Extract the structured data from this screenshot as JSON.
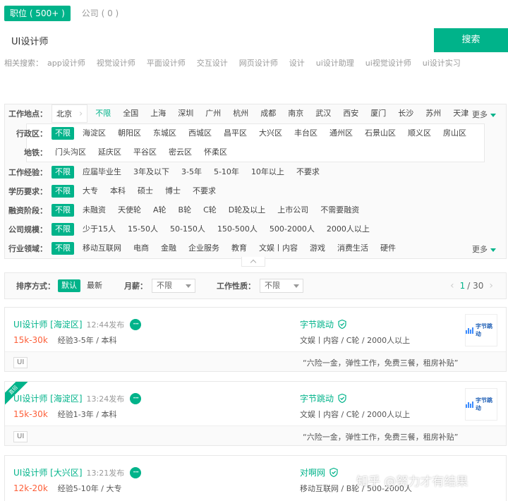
{
  "tabs": {
    "positions": "职位 ( 500+ )",
    "companies": "公司 ( 0 )"
  },
  "search": {
    "value": "UI设计师",
    "button": "搜索"
  },
  "related": {
    "label": "相关搜索：",
    "keywords": [
      "app设计师",
      "视觉设计师",
      "平面设计师",
      "交互设计",
      "网页设计师",
      "设计",
      "ui设计助理",
      "ui视觉设计师",
      "ui设计实习"
    ]
  },
  "filters": {
    "location": {
      "label": "工作地点：",
      "current": "北京",
      "options": [
        "不限",
        "全国",
        "上海",
        "深圳",
        "广州",
        "杭州",
        "成都",
        "南京",
        "武汉",
        "西安",
        "厦门",
        "长沙",
        "苏州",
        "天津"
      ],
      "more": "更多"
    },
    "district": {
      "label": "行政区：",
      "options": [
        "不限",
        "海淀区",
        "朝阳区",
        "东城区",
        "西城区",
        "昌平区",
        "大兴区",
        "丰台区",
        "通州区",
        "石景山区",
        "顺义区",
        "房山区"
      ],
      "options_row2": [
        "门头沟区",
        "延庆区",
        "平谷区",
        "密云区",
        "怀柔区"
      ]
    },
    "subway": {
      "label": "地铁："
    },
    "experience": {
      "label": "工作经验：",
      "options": [
        "不限",
        "应届毕业生",
        "3年及以下",
        "3-5年",
        "5-10年",
        "10年以上",
        "不要求"
      ]
    },
    "education": {
      "label": "学历要求：",
      "options": [
        "不限",
        "大专",
        "本科",
        "硕士",
        "博士",
        "不要求"
      ]
    },
    "funding": {
      "label": "融资阶段：",
      "options": [
        "不限",
        "未融资",
        "天使轮",
        "A轮",
        "B轮",
        "C轮",
        "D轮及以上",
        "上市公司",
        "不需要融资"
      ]
    },
    "size": {
      "label": "公司规模：",
      "options": [
        "不限",
        "少于15人",
        "15-50人",
        "50-150人",
        "150-500人",
        "500-2000人",
        "2000人以上"
      ]
    },
    "industry": {
      "label": "行业领域：",
      "options": [
        "不限",
        "移动互联网",
        "电商",
        "金融",
        "企业服务",
        "教育",
        "文娱丨内容",
        "游戏",
        "消费生活",
        "硬件"
      ],
      "more": "更多"
    }
  },
  "sortbar": {
    "label": "排序方式：",
    "default": "默认",
    "newest": "最新",
    "salary_label": "月薪：",
    "salary_value": "不限",
    "nature_label": "工作性质：",
    "nature_value": "不限",
    "page_current": "1",
    "page_total": "/ 30"
  },
  "jobs": [
    {
      "title": "UI设计师 [海淀区]",
      "time": "12:44发布",
      "salary": "15k-30k",
      "req": "经验3-5年 / 本科",
      "company": "字节跳动",
      "industry": "文娱丨内容 / C轮 / 2000人以上",
      "tag": "UI",
      "benefit": "“六险一金，弹性工作，免费三餐，租房补贴”",
      "logo_text": "字节跳动"
    },
    {
      "title": "UI设计师 [海淀区]",
      "time": "13:24发布",
      "salary": "15k-30k",
      "req": "经验1-3年 / 本科",
      "company": "字节跳动",
      "industry": "文娱丨内容 / C轮 / 2000人以上",
      "tag": "UI",
      "benefit": "“六险一金，弹性工作，免费三餐，租房补贴”",
      "logo_text": "字节跳动",
      "ribbon": "直招"
    },
    {
      "title": "UI设计师 [大兴区]",
      "time": "13:21发布",
      "salary": "12k-20k",
      "req": "经验5-10年 / 大专",
      "company": "对啊网",
      "industry": "移动互联网 / B轮 / 500-2000人"
    }
  ],
  "watermark": "知乎 @努力才有结果",
  "colors": {
    "accent": "#00b38a",
    "salary": "#fd5f39"
  }
}
